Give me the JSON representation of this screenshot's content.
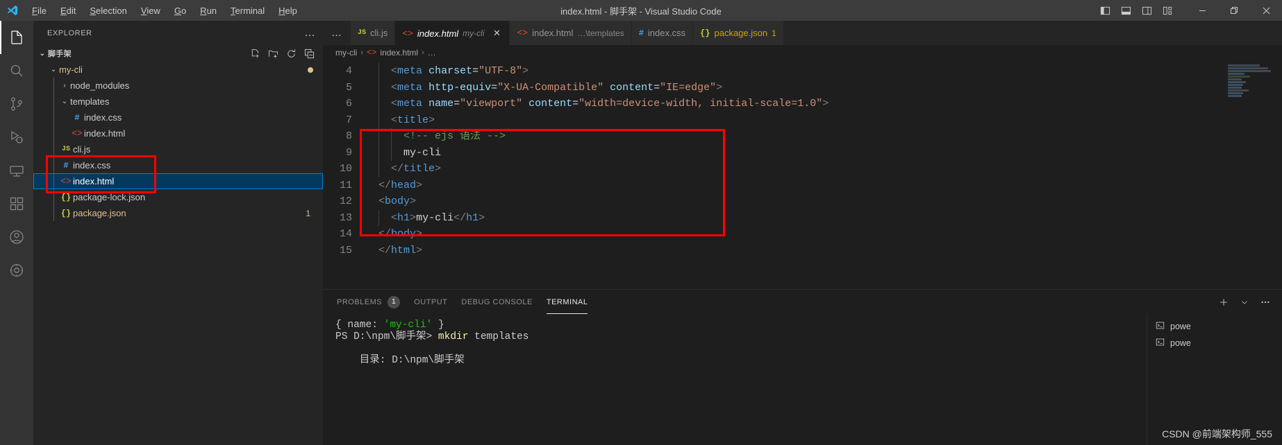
{
  "window": {
    "title": "index.html - 脚手架 - Visual Studio Code",
    "menu": [
      "File",
      "Edit",
      "Selection",
      "View",
      "Go",
      "Run",
      "Terminal",
      "Help"
    ],
    "layout_icons": [
      "toggle-primary-sidebar-icon",
      "toggle-panel-icon",
      "toggle-secondary-sidebar-icon",
      "customize-layout-icon"
    ],
    "controls": [
      "minimize",
      "restore",
      "close"
    ]
  },
  "activitybar": {
    "items": [
      {
        "name": "explorer",
        "icon": "files-icon",
        "active": true
      },
      {
        "name": "search",
        "icon": "search-icon",
        "active": false
      },
      {
        "name": "source-control",
        "icon": "source-control-icon",
        "active": false
      },
      {
        "name": "run-and-debug",
        "icon": "run-debug-icon",
        "active": false
      },
      {
        "name": "remote-explorer",
        "icon": "remote-icon",
        "active": false
      },
      {
        "name": "extensions",
        "icon": "extensions-icon",
        "active": false
      },
      {
        "name": "accounts",
        "icon": "account-icon",
        "active": false
      },
      {
        "name": "settings",
        "icon": "gear-icon",
        "active": false
      }
    ]
  },
  "sidebar": {
    "header": "EXPLORER",
    "more_actions": "…",
    "root": {
      "label": "脚手架",
      "chevron": "⌄",
      "actions": [
        "new-file-icon",
        "new-folder-icon",
        "refresh-icon",
        "collapse-all-icon"
      ]
    },
    "tree": [
      {
        "label": "my-cli",
        "kind": "folder",
        "depth": 1,
        "expanded": true,
        "modified": true,
        "dot": true
      },
      {
        "label": "node_modules",
        "kind": "folder",
        "depth": 2,
        "expanded": false
      },
      {
        "label": "templates",
        "kind": "folder",
        "depth": 2,
        "expanded": true
      },
      {
        "label": "index.css",
        "kind": "css",
        "depth": 3
      },
      {
        "label": "index.html",
        "kind": "html",
        "depth": 3
      },
      {
        "label": "cli.js",
        "kind": "js",
        "depth": 2
      },
      {
        "label": "index.css",
        "kind": "css",
        "depth": 2
      },
      {
        "label": "index.html",
        "kind": "html",
        "depth": 2,
        "selected": true
      },
      {
        "label": "package-lock.json",
        "kind": "json",
        "depth": 2
      },
      {
        "label": "package.json",
        "kind": "json",
        "depth": 2,
        "modified": true,
        "badge": "1"
      }
    ]
  },
  "editor": {
    "overflow": "…",
    "tabs": [
      {
        "label": "cli.js",
        "kind": "js",
        "active": false
      },
      {
        "label": "index.html",
        "sub": "my-cli",
        "kind": "html",
        "active": true,
        "italic": true,
        "close": "✕"
      },
      {
        "label": "index.html",
        "sub": "…\\templates",
        "kind": "html",
        "active": false
      },
      {
        "label": "index.css",
        "kind": "css",
        "active": false
      },
      {
        "label": "package.json",
        "kind": "json",
        "active": false,
        "errors": "1"
      }
    ],
    "breadcrumb": [
      "my-cli",
      "index.html",
      "…"
    ],
    "lines": [
      {
        "num": "4",
        "segments": [
          {
            "t": "  ",
            "c": "txt"
          },
          {
            "t": "<",
            "c": "tagp"
          },
          {
            "t": "meta",
            "c": "tag"
          },
          {
            "t": " ",
            "c": "txt"
          },
          {
            "t": "charset",
            "c": "attr"
          },
          {
            "t": "=",
            "c": "txt"
          },
          {
            "t": "\"UTF-8\"",
            "c": "str"
          },
          {
            "t": ">",
            "c": "tagp"
          }
        ]
      },
      {
        "num": "5",
        "segments": [
          {
            "t": "  ",
            "c": "txt"
          },
          {
            "t": "<",
            "c": "tagp"
          },
          {
            "t": "meta",
            "c": "tag"
          },
          {
            "t": " ",
            "c": "txt"
          },
          {
            "t": "http-equiv",
            "c": "attr"
          },
          {
            "t": "=",
            "c": "txt"
          },
          {
            "t": "\"X-UA-Compatible\"",
            "c": "str"
          },
          {
            "t": " ",
            "c": "txt"
          },
          {
            "t": "content",
            "c": "attr"
          },
          {
            "t": "=",
            "c": "txt"
          },
          {
            "t": "\"IE=edge\"",
            "c": "str"
          },
          {
            "t": ">",
            "c": "tagp"
          }
        ]
      },
      {
        "num": "6",
        "segments": [
          {
            "t": "  ",
            "c": "txt"
          },
          {
            "t": "<",
            "c": "tagp"
          },
          {
            "t": "meta",
            "c": "tag"
          },
          {
            "t": " ",
            "c": "txt"
          },
          {
            "t": "name",
            "c": "attr"
          },
          {
            "t": "=",
            "c": "txt"
          },
          {
            "t": "\"viewport\"",
            "c": "str"
          },
          {
            "t": " ",
            "c": "txt"
          },
          {
            "t": "content",
            "c": "attr"
          },
          {
            "t": "=",
            "c": "txt"
          },
          {
            "t": "\"width=device-width, initial-scale=1.0\"",
            "c": "str"
          },
          {
            "t": ">",
            "c": "tagp"
          }
        ]
      },
      {
        "num": "7",
        "segments": [
          {
            "t": "  ",
            "c": "txt"
          },
          {
            "t": "<",
            "c": "tagp"
          },
          {
            "t": "title",
            "c": "tag"
          },
          {
            "t": ">",
            "c": "tagp"
          }
        ]
      },
      {
        "num": "8",
        "segments": [
          {
            "t": "    ",
            "c": "txt"
          },
          {
            "t": "<!-- ejs 语法 -->",
            "c": "cmt"
          }
        ]
      },
      {
        "num": "9",
        "segments": [
          {
            "t": "    my-cli",
            "c": "txt"
          }
        ]
      },
      {
        "num": "10",
        "segments": [
          {
            "t": "  ",
            "c": "txt"
          },
          {
            "t": "</",
            "c": "tagp"
          },
          {
            "t": "title",
            "c": "tag"
          },
          {
            "t": ">",
            "c": "tagp"
          }
        ]
      },
      {
        "num": "11",
        "segments": [
          {
            "t": "</",
            "c": "tagp"
          },
          {
            "t": "head",
            "c": "tag"
          },
          {
            "t": ">",
            "c": "tagp"
          }
        ]
      },
      {
        "num": "12",
        "segments": [
          {
            "t": "<",
            "c": "tagp"
          },
          {
            "t": "body",
            "c": "tag"
          },
          {
            "t": ">",
            "c": "tagp"
          }
        ]
      },
      {
        "num": "13",
        "segments": [
          {
            "t": "  ",
            "c": "txt"
          },
          {
            "t": "<",
            "c": "tagp"
          },
          {
            "t": "h1",
            "c": "tag"
          },
          {
            "t": ">",
            "c": "tagp"
          },
          {
            "t": "my-cli",
            "c": "txt"
          },
          {
            "t": "</",
            "c": "tagp"
          },
          {
            "t": "h1",
            "c": "tag"
          },
          {
            "t": ">",
            "c": "tagp"
          }
        ]
      },
      {
        "num": "14",
        "segments": [
          {
            "t": "</",
            "c": "tagp"
          },
          {
            "t": "body",
            "c": "tag"
          },
          {
            "t": ">",
            "c": "tagp"
          }
        ]
      },
      {
        "num": "15",
        "segments": [
          {
            "t": "</",
            "c": "tagp"
          },
          {
            "t": "html",
            "c": "tag"
          },
          {
            "t": ">",
            "c": "tagp"
          }
        ]
      }
    ]
  },
  "panel": {
    "tabs": [
      {
        "label": "PROBLEMS",
        "count": "1",
        "active": false
      },
      {
        "label": "OUTPUT",
        "active": false
      },
      {
        "label": "DEBUG CONSOLE",
        "active": false
      },
      {
        "label": "TERMINAL",
        "active": true
      }
    ],
    "actions": [
      "add-terminal-icon",
      "split-chevron-icon",
      "more-actions-icon"
    ],
    "terminal_lines": [
      [
        {
          "t": "{ name: ",
          "c": ""
        },
        {
          "t": "'my-cli'",
          "c": "t-green"
        },
        {
          "t": " }",
          "c": ""
        }
      ],
      [
        {
          "t": "PS D:\\npm\\脚手架> ",
          "c": ""
        },
        {
          "t": "mkdir",
          "c": "t-yellow"
        },
        {
          "t": " templates",
          "c": ""
        }
      ],
      [
        {
          "t": "",
          "c": ""
        }
      ],
      [
        {
          "t": "    目录: D:\\npm\\脚手架",
          "c": ""
        }
      ]
    ],
    "side_items": [
      {
        "icon": "terminal-icon",
        "label": "powe"
      },
      {
        "icon": "terminal-icon",
        "label": "powe"
      }
    ]
  },
  "watermark": "CSDN @前端架构师_555",
  "colors": {
    "accent": "#007fd4",
    "selection": "#04395e",
    "modified": "#e2c08d",
    "annotation": "#ff0000",
    "comment": "#6a9955",
    "tag": "#569cd6",
    "attr": "#9cdcfe",
    "string": "#ce9178"
  }
}
